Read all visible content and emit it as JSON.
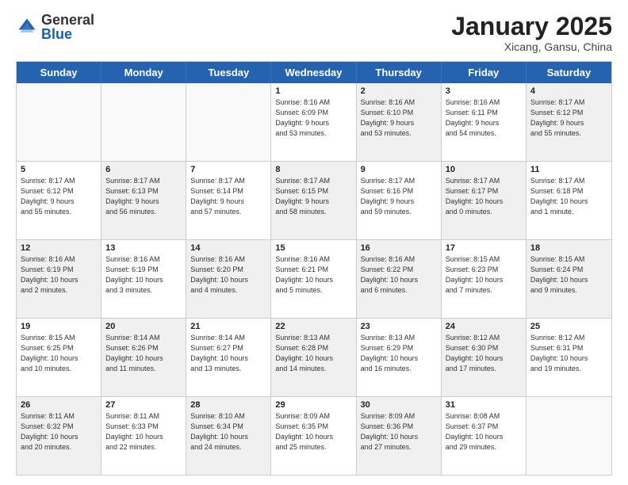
{
  "logo": {
    "general": "General",
    "blue": "Blue"
  },
  "header": {
    "month": "January 2025",
    "location": "Xicang, Gansu, China"
  },
  "weekdays": [
    "Sunday",
    "Monday",
    "Tuesday",
    "Wednesday",
    "Thursday",
    "Friday",
    "Saturday"
  ],
  "rows": [
    [
      {
        "day": "",
        "info": "",
        "shaded": false,
        "empty": true
      },
      {
        "day": "",
        "info": "",
        "shaded": false,
        "empty": true
      },
      {
        "day": "",
        "info": "",
        "shaded": false,
        "empty": true
      },
      {
        "day": "1",
        "info": "Sunrise: 8:16 AM\nSunset: 6:09 PM\nDaylight: 9 hours\nand 53 minutes.",
        "shaded": false,
        "empty": false
      },
      {
        "day": "2",
        "info": "Sunrise: 8:16 AM\nSunset: 6:10 PM\nDaylight: 9 hours\nand 53 minutes.",
        "shaded": true,
        "empty": false
      },
      {
        "day": "3",
        "info": "Sunrise: 8:16 AM\nSunset: 6:11 PM\nDaylight: 9 hours\nand 54 minutes.",
        "shaded": false,
        "empty": false
      },
      {
        "day": "4",
        "info": "Sunrise: 8:17 AM\nSunset: 6:12 PM\nDaylight: 9 hours\nand 55 minutes.",
        "shaded": true,
        "empty": false
      }
    ],
    [
      {
        "day": "5",
        "info": "Sunrise: 8:17 AM\nSunset: 6:12 PM\nDaylight: 9 hours\nand 55 minutes.",
        "shaded": false,
        "empty": false
      },
      {
        "day": "6",
        "info": "Sunrise: 8:17 AM\nSunset: 6:13 PM\nDaylight: 9 hours\nand 56 minutes.",
        "shaded": true,
        "empty": false
      },
      {
        "day": "7",
        "info": "Sunrise: 8:17 AM\nSunset: 6:14 PM\nDaylight: 9 hours\nand 57 minutes.",
        "shaded": false,
        "empty": false
      },
      {
        "day": "8",
        "info": "Sunrise: 8:17 AM\nSunset: 6:15 PM\nDaylight: 9 hours\nand 58 minutes.",
        "shaded": true,
        "empty": false
      },
      {
        "day": "9",
        "info": "Sunrise: 8:17 AM\nSunset: 6:16 PM\nDaylight: 9 hours\nand 59 minutes.",
        "shaded": false,
        "empty": false
      },
      {
        "day": "10",
        "info": "Sunrise: 8:17 AM\nSunset: 6:17 PM\nDaylight: 10 hours\nand 0 minutes.",
        "shaded": true,
        "empty": false
      },
      {
        "day": "11",
        "info": "Sunrise: 8:17 AM\nSunset: 6:18 PM\nDaylight: 10 hours\nand 1 minute.",
        "shaded": false,
        "empty": false
      }
    ],
    [
      {
        "day": "12",
        "info": "Sunrise: 8:16 AM\nSunset: 6:19 PM\nDaylight: 10 hours\nand 2 minutes.",
        "shaded": true,
        "empty": false
      },
      {
        "day": "13",
        "info": "Sunrise: 8:16 AM\nSunset: 6:19 PM\nDaylight: 10 hours\nand 3 minutes.",
        "shaded": false,
        "empty": false
      },
      {
        "day": "14",
        "info": "Sunrise: 8:16 AM\nSunset: 6:20 PM\nDaylight: 10 hours\nand 4 minutes.",
        "shaded": true,
        "empty": false
      },
      {
        "day": "15",
        "info": "Sunrise: 8:16 AM\nSunset: 6:21 PM\nDaylight: 10 hours\nand 5 minutes.",
        "shaded": false,
        "empty": false
      },
      {
        "day": "16",
        "info": "Sunrise: 8:16 AM\nSunset: 6:22 PM\nDaylight: 10 hours\nand 6 minutes.",
        "shaded": true,
        "empty": false
      },
      {
        "day": "17",
        "info": "Sunrise: 8:15 AM\nSunset: 6:23 PM\nDaylight: 10 hours\nand 7 minutes.",
        "shaded": false,
        "empty": false
      },
      {
        "day": "18",
        "info": "Sunrise: 8:15 AM\nSunset: 6:24 PM\nDaylight: 10 hours\nand 9 minutes.",
        "shaded": true,
        "empty": false
      }
    ],
    [
      {
        "day": "19",
        "info": "Sunrise: 8:15 AM\nSunset: 6:25 PM\nDaylight: 10 hours\nand 10 minutes.",
        "shaded": false,
        "empty": false
      },
      {
        "day": "20",
        "info": "Sunrise: 8:14 AM\nSunset: 6:26 PM\nDaylight: 10 hours\nand 11 minutes.",
        "shaded": true,
        "empty": false
      },
      {
        "day": "21",
        "info": "Sunrise: 8:14 AM\nSunset: 6:27 PM\nDaylight: 10 hours\nand 13 minutes.",
        "shaded": false,
        "empty": false
      },
      {
        "day": "22",
        "info": "Sunrise: 8:13 AM\nSunset: 6:28 PM\nDaylight: 10 hours\nand 14 minutes.",
        "shaded": true,
        "empty": false
      },
      {
        "day": "23",
        "info": "Sunrise: 8:13 AM\nSunset: 6:29 PM\nDaylight: 10 hours\nand 16 minutes.",
        "shaded": false,
        "empty": false
      },
      {
        "day": "24",
        "info": "Sunrise: 8:12 AM\nSunset: 6:30 PM\nDaylight: 10 hours\nand 17 minutes.",
        "shaded": true,
        "empty": false
      },
      {
        "day": "25",
        "info": "Sunrise: 8:12 AM\nSunset: 6:31 PM\nDaylight: 10 hours\nand 19 minutes.",
        "shaded": false,
        "empty": false
      }
    ],
    [
      {
        "day": "26",
        "info": "Sunrise: 8:11 AM\nSunset: 6:32 PM\nDaylight: 10 hours\nand 20 minutes.",
        "shaded": true,
        "empty": false
      },
      {
        "day": "27",
        "info": "Sunrise: 8:11 AM\nSunset: 6:33 PM\nDaylight: 10 hours\nand 22 minutes.",
        "shaded": false,
        "empty": false
      },
      {
        "day": "28",
        "info": "Sunrise: 8:10 AM\nSunset: 6:34 PM\nDaylight: 10 hours\nand 24 minutes.",
        "shaded": true,
        "empty": false
      },
      {
        "day": "29",
        "info": "Sunrise: 8:09 AM\nSunset: 6:35 PM\nDaylight: 10 hours\nand 25 minutes.",
        "shaded": false,
        "empty": false
      },
      {
        "day": "30",
        "info": "Sunrise: 8:09 AM\nSunset: 6:36 PM\nDaylight: 10 hours\nand 27 minutes.",
        "shaded": true,
        "empty": false
      },
      {
        "day": "31",
        "info": "Sunrise: 8:08 AM\nSunset: 6:37 PM\nDaylight: 10 hours\nand 29 minutes.",
        "shaded": false,
        "empty": false
      },
      {
        "day": "",
        "info": "",
        "shaded": false,
        "empty": true
      }
    ]
  ]
}
